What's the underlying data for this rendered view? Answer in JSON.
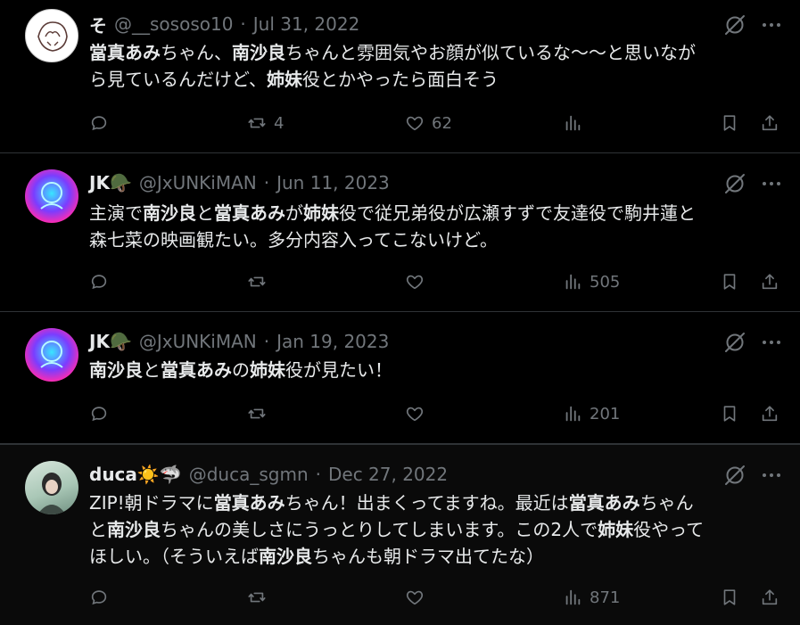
{
  "tweets": [
    {
      "name": "そ",
      "handle": "@__sososo10",
      "separator": "·",
      "date": "Jul 31, 2022",
      "text_lines": [
        [
          {
            "t": "當真あみ",
            "b": true
          },
          {
            "t": "ちゃん、",
            "b": false
          },
          {
            "t": "南沙良",
            "b": true
          },
          {
            "t": "ちゃんと雰囲気やお顔が似ているな〜〜と思いなが",
            "b": false
          }
        ],
        [
          {
            "t": "ら見ているんだけど、",
            "b": false
          },
          {
            "t": "姉妹",
            "b": true
          },
          {
            "t": "役とかやったら面白そう",
            "b": false
          }
        ]
      ],
      "reply_count": "",
      "repost_count": "4",
      "like_count": "62",
      "view_count": ""
    },
    {
      "name": "JK🪖",
      "handle": "@JxUNKiMAN",
      "separator": "·",
      "date": "Jun 11, 2023",
      "text_lines": [
        [
          {
            "t": "主演で",
            "b": false
          },
          {
            "t": "南沙良",
            "b": true
          },
          {
            "t": "と",
            "b": false
          },
          {
            "t": "當真あみ",
            "b": true
          },
          {
            "t": "が",
            "b": false
          },
          {
            "t": "姉妹",
            "b": true
          },
          {
            "t": "役で従兄弟役が広瀬すずで友達役で駒井蓮と",
            "b": false
          }
        ],
        [
          {
            "t": "森七菜の映画観たい。多分内容入ってこないけど。",
            "b": false
          }
        ]
      ],
      "reply_count": "",
      "repost_count": "",
      "like_count": "",
      "view_count": "505"
    },
    {
      "name": "JK🪖",
      "handle": "@JxUNKiMAN",
      "separator": "·",
      "date": "Jan 19, 2023",
      "text_lines": [
        [
          {
            "t": "南沙良",
            "b": true
          },
          {
            "t": "と",
            "b": false
          },
          {
            "t": "當真あみ",
            "b": true
          },
          {
            "t": "の",
            "b": false
          },
          {
            "t": "姉妹",
            "b": true
          },
          {
            "t": "役が見たい！",
            "b": false
          }
        ]
      ],
      "reply_count": "",
      "repost_count": "",
      "like_count": "",
      "view_count": "201"
    },
    {
      "name": "duca☀️🦈",
      "handle": "@duca_sgmn",
      "separator": "·",
      "date": "Dec 27, 2022",
      "text_lines": [
        [
          {
            "t": "ZIP!朝ドラマに",
            "b": false
          },
          {
            "t": "當真あみ",
            "b": true
          },
          {
            "t": "ちゃん！出まくってますね。最近は",
            "b": false
          },
          {
            "t": "當真あみ",
            "b": true
          },
          {
            "t": "ちゃん",
            "b": false
          }
        ],
        [
          {
            "t": "と",
            "b": false
          },
          {
            "t": "南沙良",
            "b": true
          },
          {
            "t": "ちゃんの美しさにうっとりしてしまいます。この2人で",
            "b": false
          },
          {
            "t": "姉妹",
            "b": true
          },
          {
            "t": "役やって",
            "b": false
          }
        ],
        [
          {
            "t": "ほしい。（そういえば",
            "b": false
          },
          {
            "t": "南沙良",
            "b": true
          },
          {
            "t": "ちゃんも朝ドラマ出てたな）",
            "b": false
          }
        ]
      ],
      "reply_count": "",
      "repost_count": "",
      "like_count": "",
      "view_count": "871"
    }
  ],
  "colors": {
    "background": "#000000",
    "text": "#e7e9ea",
    "secondary": "#71767b",
    "divider": "#2f3336"
  },
  "icons": [
    "reply-icon",
    "repost-icon",
    "like-icon",
    "views-icon",
    "bookmark-icon",
    "share-icon",
    "grok-icon",
    "more-icon"
  ]
}
